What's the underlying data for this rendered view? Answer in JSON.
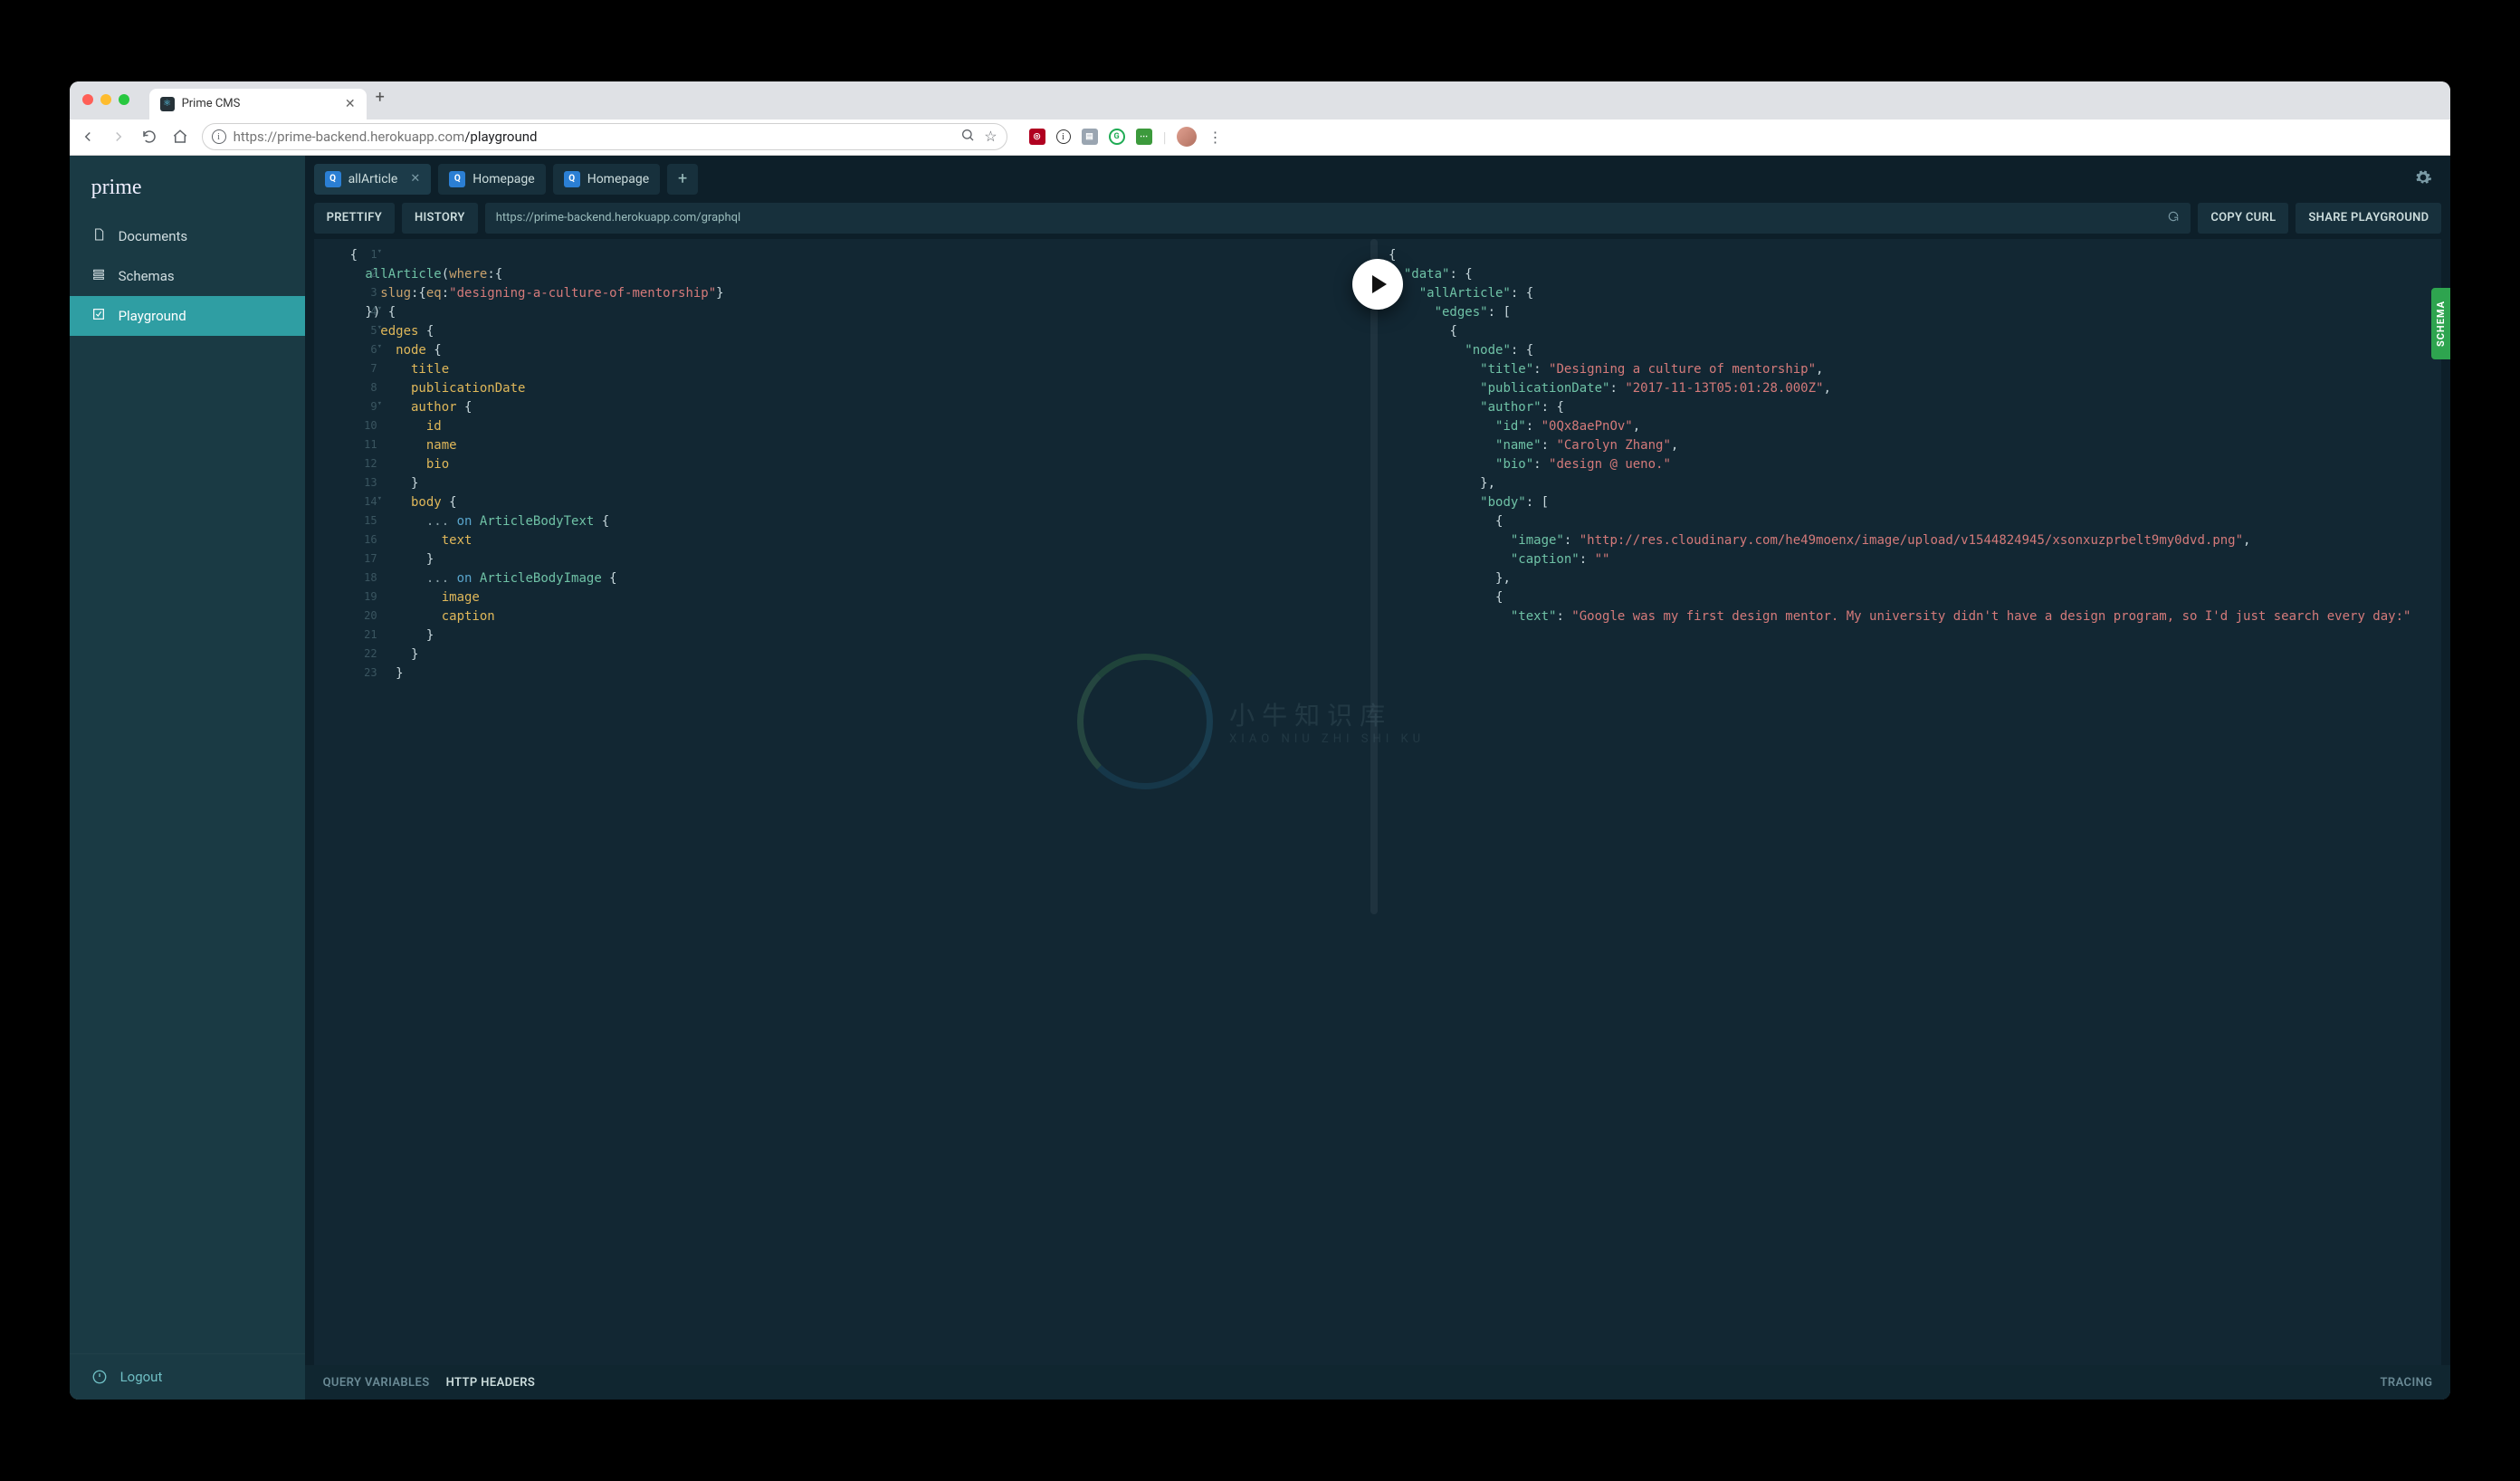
{
  "browser": {
    "tab_title": "Prime CMS",
    "url_display_host": "https://prime-backend.herokuapp.com",
    "url_display_path": "/playground"
  },
  "sidebar": {
    "brand": "prime",
    "items": [
      {
        "label": "Documents",
        "icon": "document-icon",
        "active": false
      },
      {
        "label": "Schemas",
        "icon": "schema-icon",
        "active": false
      },
      {
        "label": "Playground",
        "icon": "playground-icon",
        "active": true
      }
    ],
    "logout_label": "Logout"
  },
  "playground": {
    "tabs": [
      {
        "label": "allArticle",
        "active": true,
        "closable": true
      },
      {
        "label": "Homepage",
        "active": false,
        "closable": false
      },
      {
        "label": "Homepage",
        "active": false,
        "closable": false
      }
    ],
    "toolbar": {
      "prettify": "PRETTIFY",
      "history": "HISTORY",
      "copy_curl": "COPY CURL",
      "share": "SHARE PLAYGROUND"
    },
    "endpoint": "https://prime-backend.herokuapp.com/graphql",
    "footer": {
      "query_variables": "QUERY VARIABLES",
      "http_headers": "HTTP HEADERS",
      "tracing": "TRACING"
    },
    "schema_tab": "SCHEMA"
  },
  "query": {
    "lines": [
      "{",
      "  allArticle(where:{",
      "    slug:{eq:\"designing-a-culture-of-mentorship\"}",
      "  }) {",
      "    edges {",
      "      node {",
      "        title",
      "        publicationDate",
      "        author {",
      "          id",
      "          name",
      "          bio",
      "        }",
      "        body {",
      "          ... on ArticleBodyText {",
      "            text",
      "          }",
      "          ... on ArticleBodyImage {",
      "            image",
      "            caption",
      "          }",
      "        }",
      "      }"
    ],
    "line_numbers": [
      "1",
      "2",
      "3",
      "4",
      "5",
      "6",
      "7",
      "8",
      "9",
      "10",
      "11",
      "12",
      "13",
      "14",
      "15",
      "16",
      "17",
      "18",
      "19",
      "20",
      "21",
      "22",
      "23"
    ],
    "fold_lines": [
      1,
      4,
      5,
      6,
      9,
      14
    ]
  },
  "response": {
    "data": {
      "allArticle": {
        "edges": [
          {
            "node": {
              "title": "Designing a culture of mentorship",
              "publicationDate": "2017-11-13T05:01:28.000Z",
              "author": {
                "id": "0Qx8aePnOv",
                "name": "Carolyn Zhang",
                "bio": "design @ ueno."
              },
              "body": [
                {
                  "image": "http://res.cloudinary.com/he49moenx/image/upload/v1544824945/xsonxuzprbelt9my0dvd.png",
                  "caption": ""
                },
                {
                  "text": "Google was my first design mentor. My university didn't have a design program, so I'd just search every day:"
                }
              ]
            }
          }
        ]
      }
    }
  },
  "watermark": {
    "main": "小牛知识库",
    "sub": "XIAO NIU ZHI SHI KU"
  }
}
